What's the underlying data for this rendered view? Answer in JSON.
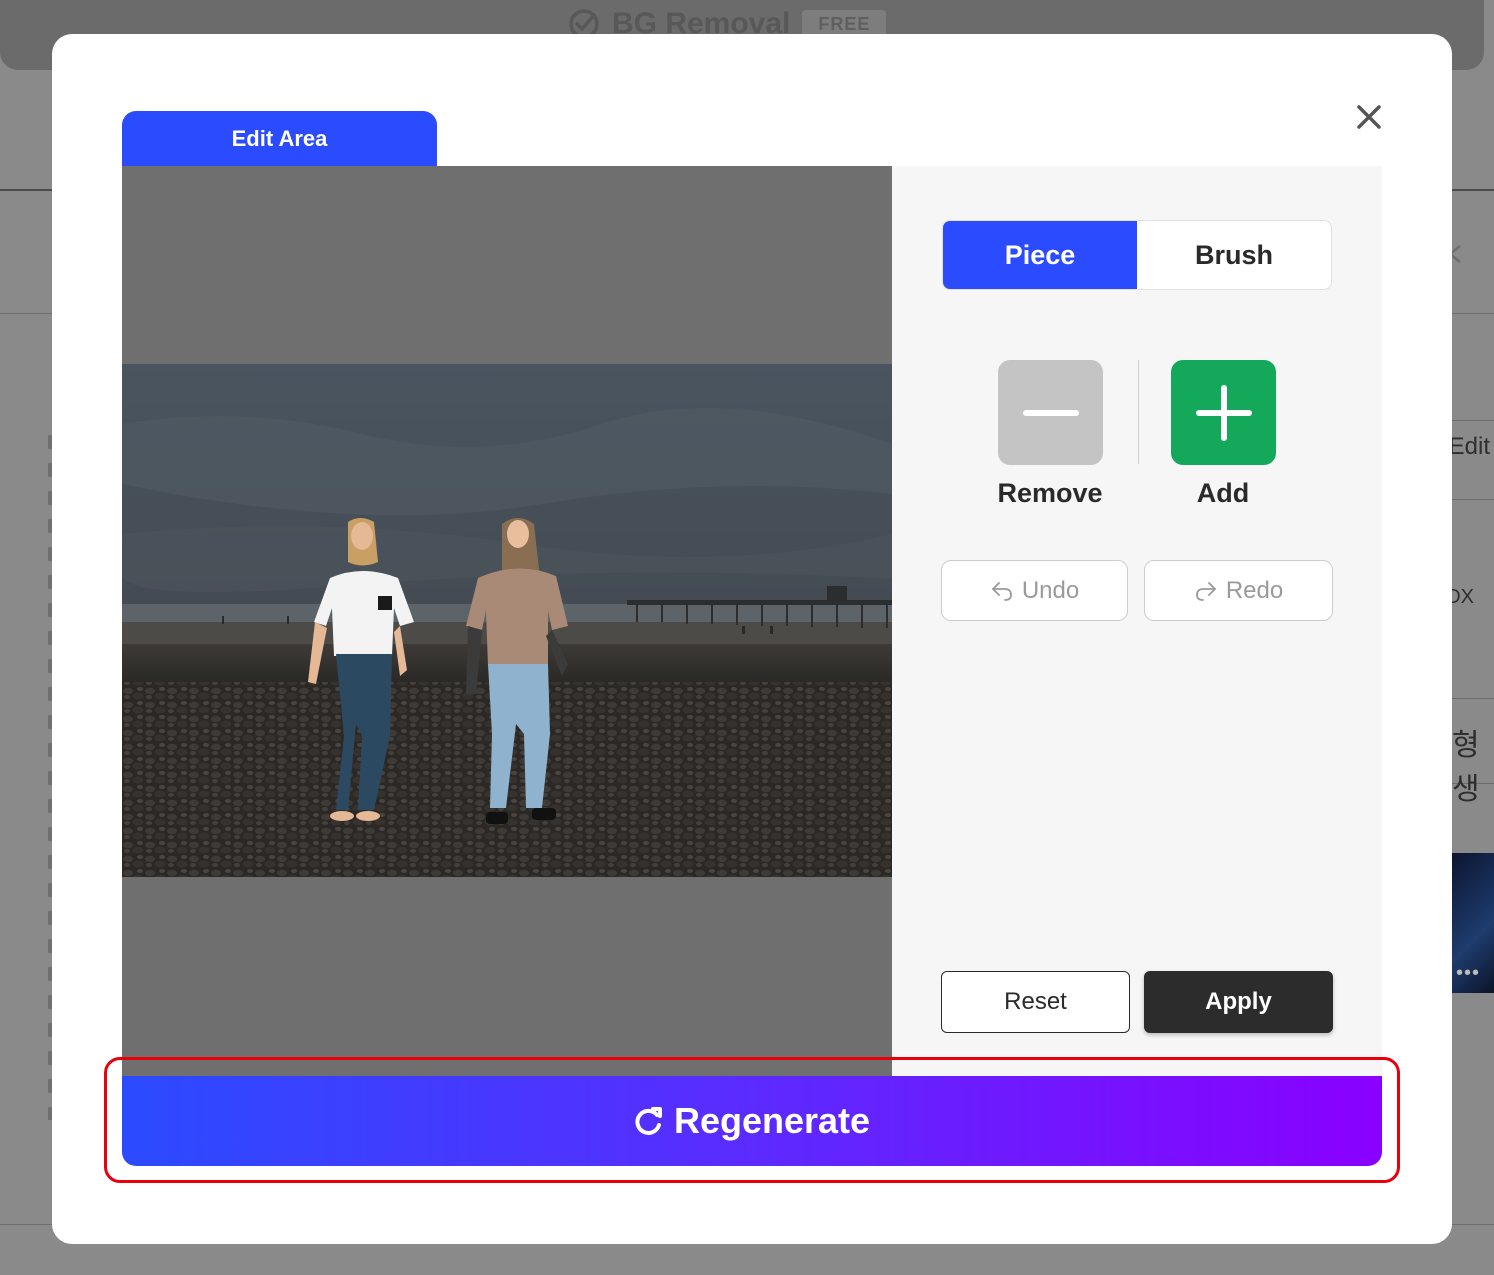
{
  "background": {
    "brand_title": "BG Removal",
    "brand_badge": "FREE",
    "side_edit_text": "Edit",
    "side_box_text": "DX",
    "side_korean_text": "형 생",
    "more_dots": "•••"
  },
  "modal": {
    "tab_label": "Edit Area",
    "close_icon": "close-icon",
    "segment": {
      "active": "Piece",
      "piece_label": "Piece",
      "brush_label": "Brush"
    },
    "modes": {
      "remove_label": "Remove",
      "add_label": "Add"
    },
    "history": {
      "undo_label": "Undo",
      "redo_label": "Redo"
    },
    "actions": {
      "reset_label": "Reset",
      "apply_label": "Apply"
    },
    "regenerate_label": "Regenerate",
    "colors": {
      "primary_blue": "#2b4bff",
      "add_green": "#14a85b",
      "remove_gray": "#c4c4c4",
      "apply_dark": "#2c2c2c",
      "gradient_end": "#8a00ff",
      "highlight_red": "#e8000b"
    }
  }
}
